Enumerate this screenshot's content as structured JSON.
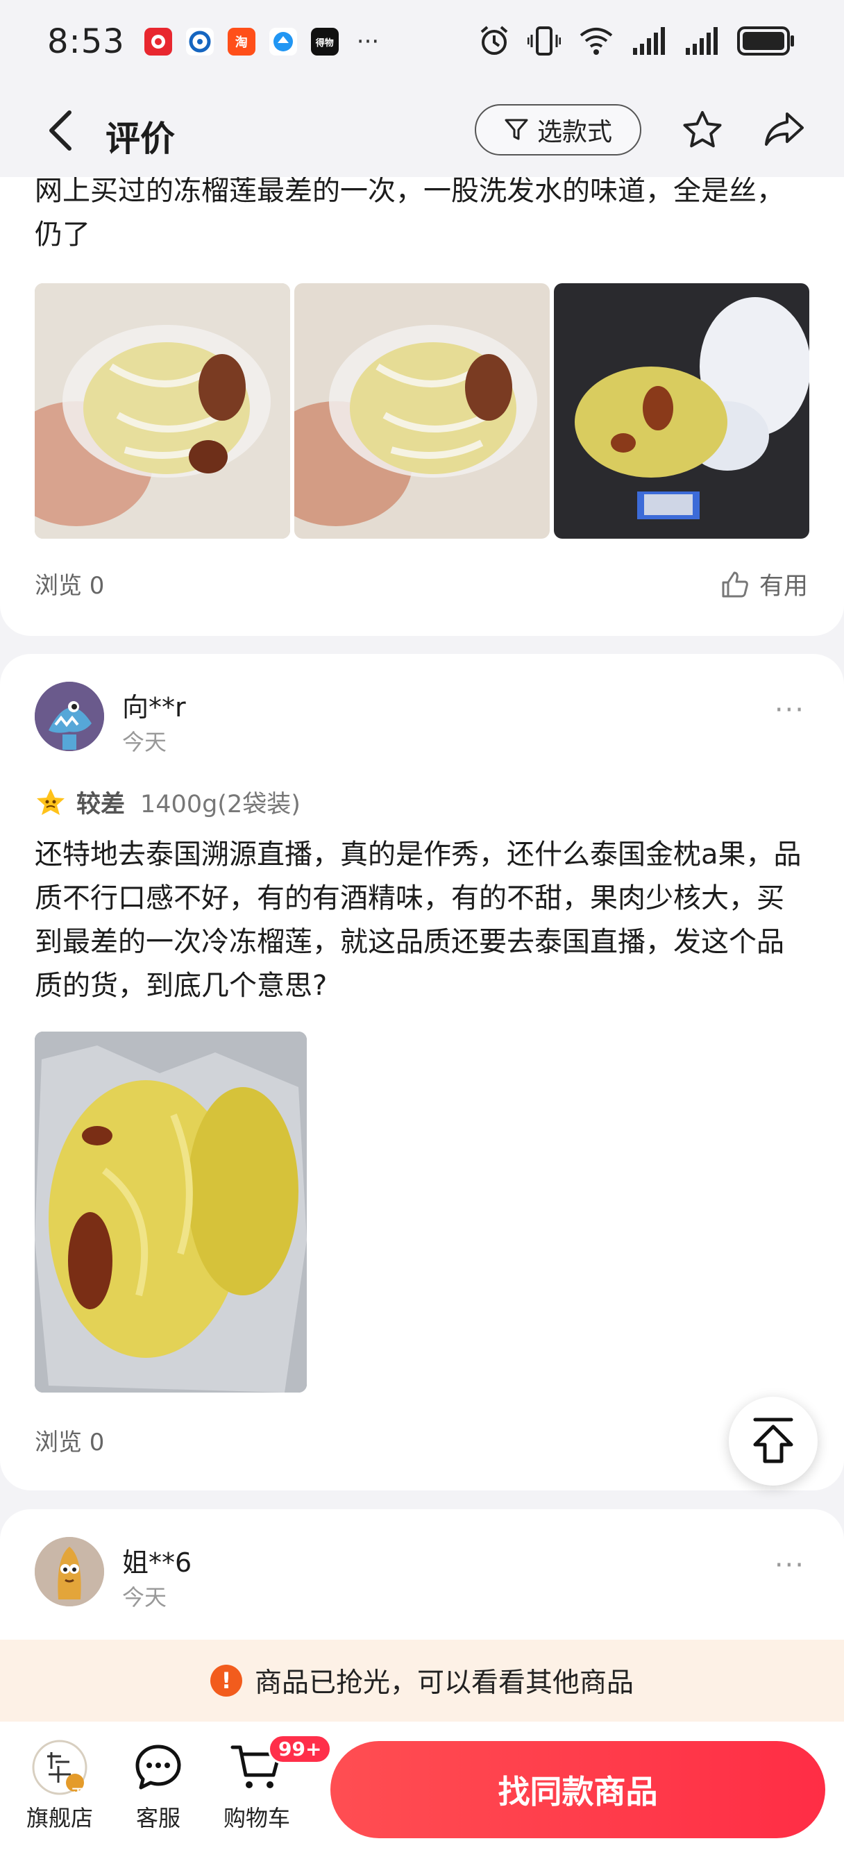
{
  "status_bar": {
    "time": "8:53",
    "notif_icons": [
      "jd-app-icon",
      "baidu-app-icon",
      "taobao-app-icon",
      "browser-app-icon",
      "dewu-app-icon"
    ],
    "taobao_glyph": "淘",
    "dewu_glyph": "得物",
    "more": "···"
  },
  "header": {
    "title": "评价",
    "filter_label": "选款式"
  },
  "review1": {
    "text": "网上买过的冻榴莲最差的一次，一股洗发水的味道，全是丝，仍了",
    "views": "浏览 0",
    "useful": "有用"
  },
  "review2": {
    "user": "向**r",
    "date": "今天",
    "rating": "较差",
    "spec": "1400g(2袋装)",
    "text": "还特地去泰国溯源直播，真的是作秀，还什么泰国金枕a果，品质不行口感不好，有的有酒精味，有的不甜，果肉少核大，买到最差的一次冷冻榴莲，就这品质还要去泰国直播，发这个品质的货，到底几个意思?",
    "views": "浏览 0",
    "more": "···"
  },
  "review3": {
    "user": "姐**6",
    "date": "今天",
    "more": "···"
  },
  "banner": {
    "icon": "!",
    "text": "商品已抢光，可以看看其他商品"
  },
  "bottom_bar": {
    "store_label": "旗舰店",
    "store_badge": "正",
    "service_label": "客服",
    "cart_label": "购物车",
    "cart_badge": "99+",
    "cta_label": "找同款商品"
  },
  "colors": {
    "accent": "#ff2d45",
    "warning": "#f25c1d",
    "banner_bg": "#fdf1e6",
    "page_bg": "#f3f3f6"
  }
}
